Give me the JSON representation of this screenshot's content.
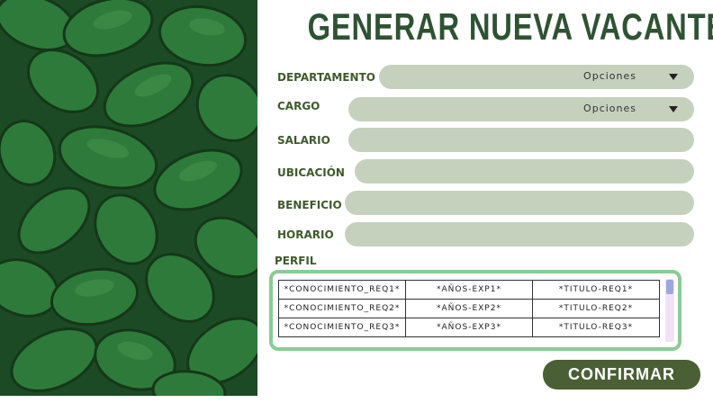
{
  "title": "GENERAR NUEVA VACANTE",
  "form": {
    "departamento": {
      "label": "DEPARTAMENTO",
      "value": "Opciones"
    },
    "cargo": {
      "label": "CARGO",
      "value": "Opciones"
    },
    "salario": {
      "label": "SALARIO",
      "value": ""
    },
    "ubicacion": {
      "label": "UBICACIÓN",
      "value": ""
    },
    "beneficio": {
      "label": "BENEFICIO",
      "value": ""
    },
    "horario": {
      "label": "HORARIO",
      "value": ""
    }
  },
  "perfil": {
    "label": "PERFIL",
    "rows": [
      [
        "*CONOCIMIENTO_REQ1*",
        "*AÑOS-EXP1*",
        "*TITULO-REQ1*"
      ],
      [
        "*CONOCIMIENTO_REQ2*",
        "*AÑOS-EXP2*",
        "*TITULO-REQ2*"
      ],
      [
        "*CONOCIMIENTO_REQ3*",
        "*AÑOS-EXP3*",
        "*TITULO-REQ3*"
      ]
    ]
  },
  "confirm_label": "CONFIRMAR",
  "colors": {
    "title": "#2f5233",
    "label": "#3f5a2b",
    "field": "#c6d1bd",
    "perfil_border": "#8ccb94",
    "button": "#4a5f34"
  },
  "icons": {
    "dropdown": "triangle-down"
  }
}
